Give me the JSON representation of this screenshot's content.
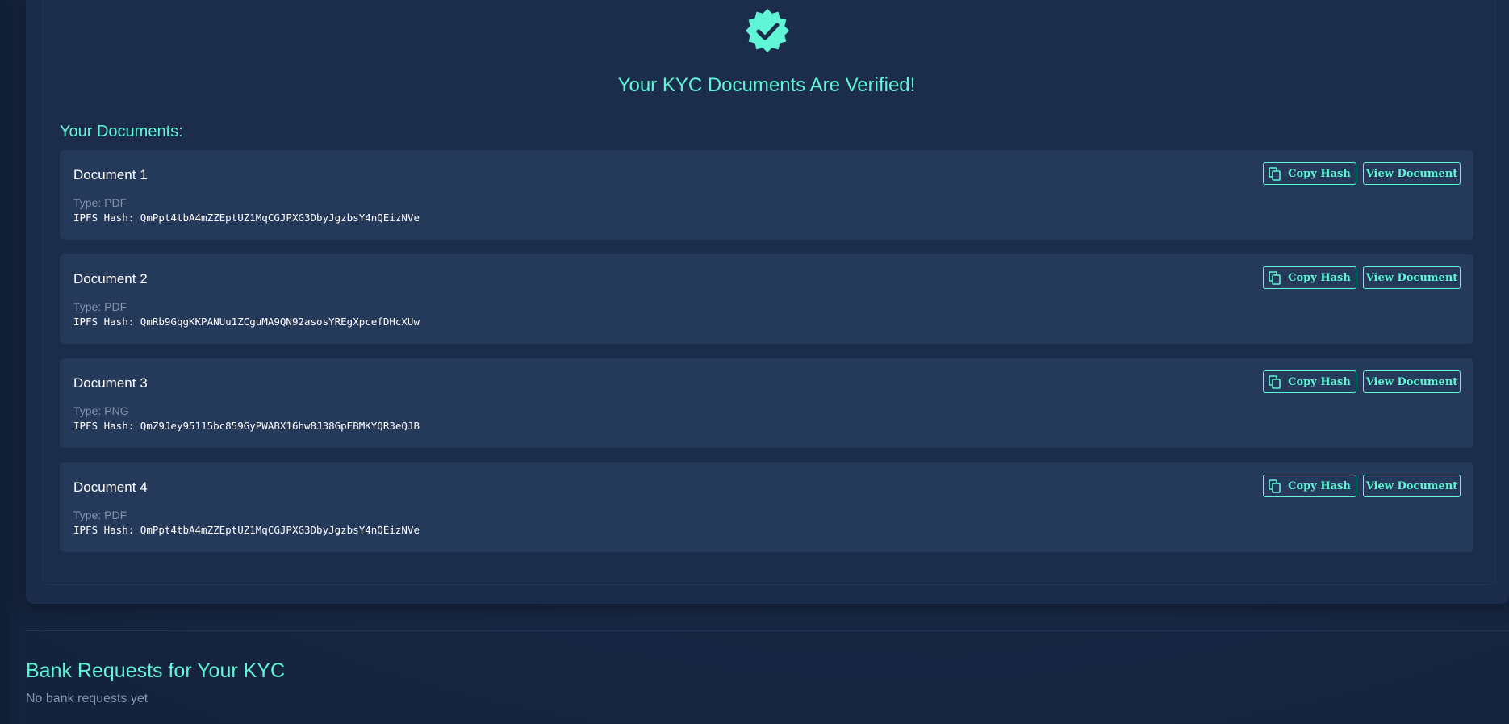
{
  "colors": {
    "accent": "#5ff5d6",
    "background": "#172640",
    "card": "#25395a",
    "muted_text": "#8492ad"
  },
  "verification": {
    "badge_icon": "verified-check-badge-icon",
    "title": "Your KYC Documents Are Verified!"
  },
  "documents": {
    "heading": "Your Documents:",
    "type_prefix": "Type: ",
    "hash_prefix": "IPFS Hash: ",
    "copy_label": "Copy Hash",
    "copy_icon": "copy-icon",
    "view_label": "View Document",
    "items": [
      {
        "name": "Document 1",
        "type": "PDF",
        "hash": "QmPpt4tbA4mZZEptUZ1MqCGJPXG3DbyJgzbsY4nQEizNVe"
      },
      {
        "name": "Document 2",
        "type": "PDF",
        "hash": "QmRb9GqgKKPANUu1ZCguMA9QN92asosYREgXpcefDHcXUw"
      },
      {
        "name": "Document 3",
        "type": "PNG",
        "hash": "QmZ9Jey95115bc859GyPWABX16hw8J38GpEBMKYQR3eQJB"
      },
      {
        "name": "Document 4",
        "type": "PDF",
        "hash": "QmPpt4tbA4mZZEptUZ1MqCGJPXG3DbyJgzbsY4nQEizNVe"
      }
    ]
  },
  "bank_requests": {
    "heading": "Bank Requests for Your KYC",
    "empty_text": "No bank requests yet"
  }
}
